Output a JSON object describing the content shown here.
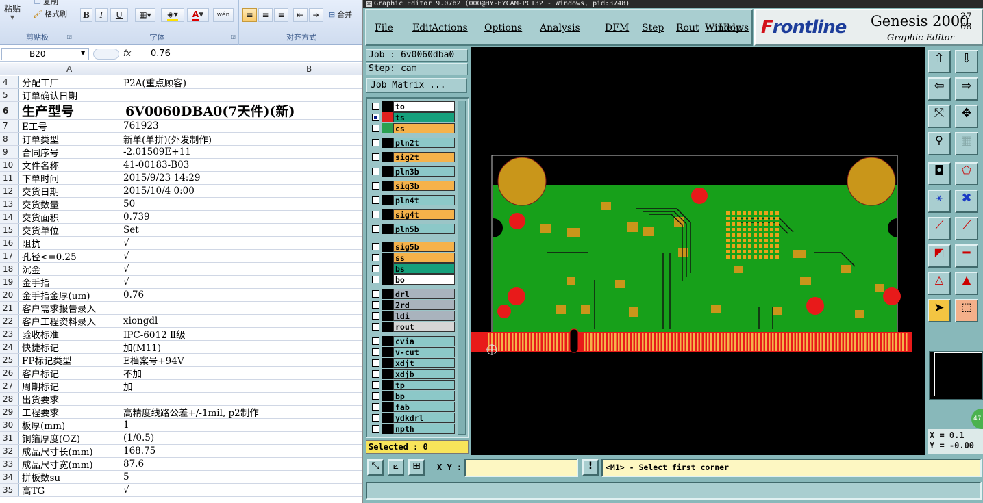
{
  "excel": {
    "ribbon": {
      "clipboard": {
        "paste": "粘贴",
        "copy": "复制",
        "format_painter": "格式刷",
        "label": "剪贴板"
      },
      "font": {
        "bold": "B",
        "italic": "I",
        "underline": "U",
        "font_color": "A",
        "phonetic": "wén",
        "label": "字体"
      },
      "alignment": {
        "merge": "合并",
        "label": "对齐方式"
      }
    },
    "formula_bar": {
      "name_box": "B20",
      "fx": "fx",
      "value": "0.76"
    },
    "columns": {
      "a": "A",
      "b": "B"
    },
    "rows": [
      {
        "n": "4",
        "a": "分配工厂",
        "b": "P2A(重点顾客)"
      },
      {
        "n": "5",
        "a": "订单确认日期",
        "b": ""
      },
      {
        "n": "6",
        "a": "生产型号",
        "b": "6V0060DBA0(7天件)(新)"
      },
      {
        "n": "7",
        "a": "E工号",
        "b": "761923"
      },
      {
        "n": "8",
        "a": "订单类型",
        "b": "新单(单拼)(外发制作)"
      },
      {
        "n": "9",
        "a": "合同序号",
        "b": "-2.01509E+11"
      },
      {
        "n": "10",
        "a": "文件名称",
        "b": "41-00183-B03"
      },
      {
        "n": "11",
        "a": "下单时间",
        "b": "2015/9/23 14:29"
      },
      {
        "n": "12",
        "a": "交货日期",
        "b": "2015/10/4 0:00"
      },
      {
        "n": "13",
        "a": "交货数量",
        "b": "50"
      },
      {
        "n": "14",
        "a": "交货面积",
        "b": "0.739"
      },
      {
        "n": "15",
        "a": "交货单位",
        "b": "Set"
      },
      {
        "n": "16",
        "a": "阻抗",
        "b": "√"
      },
      {
        "n": "17",
        "a": "孔径<=0.25",
        "b": "√"
      },
      {
        "n": "18",
        "a": "沉金",
        "b": "√"
      },
      {
        "n": "19",
        "a": "金手指",
        "b": "√"
      },
      {
        "n": "20",
        "a": "金手指金厚(um)",
        "b": "0.76"
      },
      {
        "n": "21",
        "a": "客户需求报告录入",
        "b": ""
      },
      {
        "n": "22",
        "a": "客户工程资料录入",
        "b": "xiongdl"
      },
      {
        "n": "23",
        "a": "验收标准",
        "b": "IPC-6012 Ⅱ级"
      },
      {
        "n": "24",
        "a": "快捷标记",
        "b": "加(M11)"
      },
      {
        "n": "25",
        "a": "FP标记类型",
        "b": "E档案号+94V"
      },
      {
        "n": "26",
        "a": "客户标记",
        "b": "不加"
      },
      {
        "n": "27",
        "a": "周期标记",
        "b": "加"
      },
      {
        "n": "28",
        "a": "出货要求",
        "b": ""
      },
      {
        "n": "29",
        "a": "工程要求",
        "b": "高精度线路公差+/-1mil, p2制作"
      },
      {
        "n": "30",
        "a": "板厚(mm)",
        "b": "1"
      },
      {
        "n": "31",
        "a": "铜箔厚度(OZ)",
        "b": "(1/0.5)"
      },
      {
        "n": "32",
        "a": "成品尺寸长(mm)",
        "b": "168.75"
      },
      {
        "n": "33",
        "a": "成品尺寸宽(mm)",
        "b": "87.6"
      },
      {
        "n": "34",
        "a": "拼板数su",
        "b": "5"
      },
      {
        "n": "35",
        "a": "高TG",
        "b": "√"
      }
    ]
  },
  "genesis": {
    "title": "Graphic Editor 9.07b2 (OOO@HY-HYCAM-PC132 - Windows, pid:3748)",
    "menu": [
      "File",
      "Edit",
      "Actions",
      "Options",
      "Analysis",
      "DFM",
      "Step",
      "Rout",
      "Windows",
      "Help"
    ],
    "logo": {
      "brand_a": "F",
      "brand_b": "rontline",
      "product": "Genesis 2000",
      "version": "27 08",
      "subtitle": "Graphic Editor"
    },
    "job": "Job : 6v0060dba0",
    "step": "Step: cam",
    "job_matrix": "Job Matrix ...",
    "layers": [
      {
        "name": "to",
        "color": "#ffffff",
        "sw": "#000000",
        "sel": false
      },
      {
        "name": "ts",
        "color": "#16a07c",
        "sw": "#e02020",
        "sel": true
      },
      {
        "name": "cs",
        "color": "#f5b24a",
        "sw": "#2aa050",
        "sel": false
      },
      {
        "name": "pln2t",
        "color": "#8cc8c8",
        "sw": "#000000",
        "sel": false
      },
      {
        "name": "sig2t",
        "color": "#f5b24a",
        "sw": "#000000",
        "sel": false
      },
      {
        "name": "pln3b",
        "color": "#8cc8c8",
        "sw": "#000000",
        "sel": false
      },
      {
        "name": "sig3b",
        "color": "#f5b24a",
        "sw": "#000000",
        "sel": false
      },
      {
        "name": "pln4t",
        "color": "#8cc8c8",
        "sw": "#000000",
        "sel": false
      },
      {
        "name": "sig4t",
        "color": "#f5b24a",
        "sw": "#000000",
        "sel": false
      },
      {
        "name": "pln5b",
        "color": "#8cc8c8",
        "sw": "#000000",
        "sel": false
      },
      {
        "name": "sig5b",
        "color": "#f5b24a",
        "sw": "#000000",
        "sel": false
      },
      {
        "name": "ss",
        "color": "#f5b24a",
        "sw": "#000000",
        "sel": false
      },
      {
        "name": "bs",
        "color": "#16a07c",
        "sw": "#000000",
        "sel": false
      },
      {
        "name": "bo",
        "color": "#ffffff",
        "sw": "#000000",
        "sel": false
      },
      {
        "name": "drl",
        "color": "#a9b3bd",
        "sw": "#000000",
        "sel": false
      },
      {
        "name": "2rd",
        "color": "#a9b3bd",
        "sw": "#000000",
        "sel": false
      },
      {
        "name": "ldi",
        "color": "#a9b3bd",
        "sw": "#000000",
        "sel": false
      },
      {
        "name": "rout",
        "color": "#d6d6d6",
        "sw": "#000000",
        "sel": false
      },
      {
        "name": "cvia",
        "color": "#8cc8c8",
        "sw": "#000000",
        "sel": false
      },
      {
        "name": "v-cut",
        "color": "#8cc8c8",
        "sw": "#000000",
        "sel": false
      },
      {
        "name": "xdjt",
        "color": "#8cc8c8",
        "sw": "#000000",
        "sel": false
      },
      {
        "name": "xdjb",
        "color": "#8cc8c8",
        "sw": "#000000",
        "sel": false
      },
      {
        "name": "tp",
        "color": "#8cc8c8",
        "sw": "#000000",
        "sel": false
      },
      {
        "name": "bp",
        "color": "#8cc8c8",
        "sw": "#000000",
        "sel": false
      },
      {
        "name": "fab",
        "color": "#8cc8c8",
        "sw": "#000000",
        "sel": false
      },
      {
        "name": "ydkdrl",
        "color": "#8cc8c8",
        "sw": "#000000",
        "sel": false
      },
      {
        "name": "npth",
        "color": "#8cc8c8",
        "sw": "#000000",
        "sel": false
      }
    ],
    "selected": "Selected : 0",
    "xy_label": "X Y :",
    "xy_value": "",
    "message": "<M1> - Select first corner",
    "coords": {
      "x": "X = 0.1",
      "y": "Y = -0.00"
    },
    "badge": "47"
  }
}
